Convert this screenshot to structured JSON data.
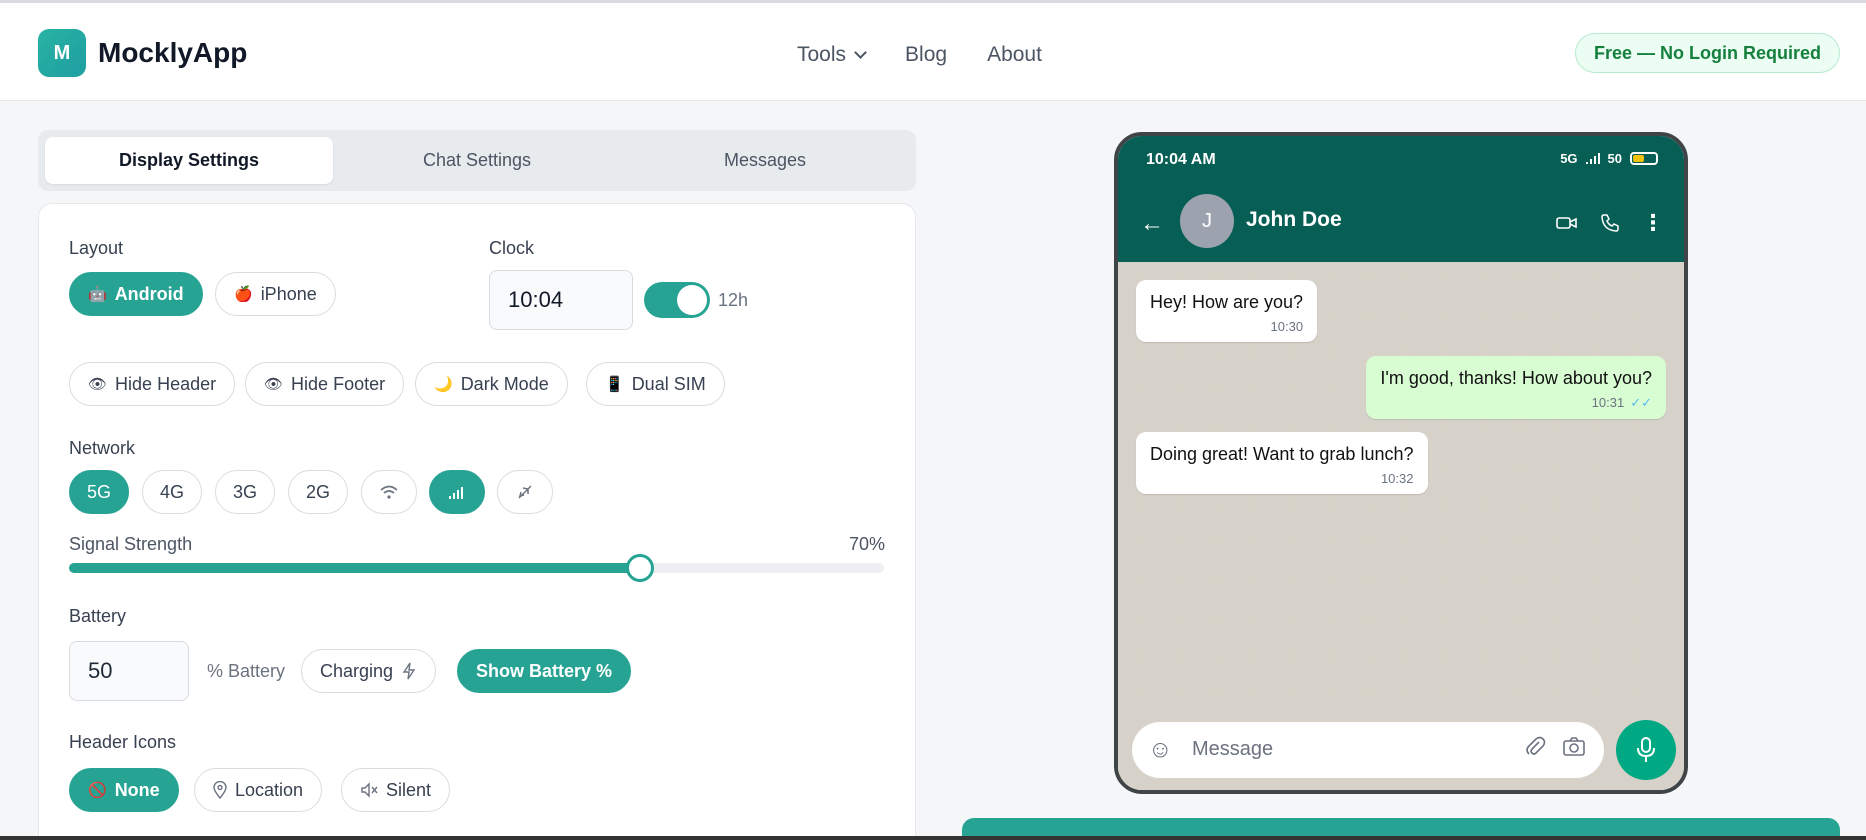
{
  "app": {
    "logo_letter": "M",
    "name": "MocklyApp"
  },
  "nav": {
    "tools": "Tools",
    "blog": "Blog",
    "about": "About",
    "badge": "Free — No Login Required"
  },
  "tabs": [
    "Display Settings",
    "Chat Settings",
    "Messages"
  ],
  "settings": {
    "layout_label": "Layout",
    "layout_android": "Android",
    "layout_iphone": "iPhone",
    "clock_label": "Clock",
    "clock_value": "10:04",
    "clock_format": "12h",
    "hide_header": "Hide Header",
    "hide_footer": "Hide Footer",
    "dark_mode": "Dark Mode",
    "dual_sim": "Dual SIM",
    "network_label": "Network",
    "networks": [
      "5G",
      "4G",
      "3G",
      "2G"
    ],
    "signal_label": "Signal Strength",
    "signal_value": "70%",
    "signal_fraction": 0.7,
    "battery_label": "Battery",
    "battery_value": "50",
    "battery_suffix": "% Battery",
    "charging": "Charging",
    "show_battery": "Show Battery %",
    "header_icons_label": "Header Icons",
    "hi_none": "None",
    "hi_location": "Location",
    "hi_silent": "Silent"
  },
  "phone": {
    "time": "10:04 AM",
    "network": "5G",
    "battery": "50",
    "battery_fraction": 0.5,
    "contact_initial": "J",
    "contact_name": "John Doe",
    "messages": [
      {
        "text": "Hey! How are you?",
        "time": "10:30"
      },
      {
        "text": "I'm good, thanks! How about you?",
        "time": "10:31"
      },
      {
        "text": "Doing great! Want to grab lunch?",
        "time": "10:32"
      }
    ],
    "input_placeholder": "Message"
  },
  "colors": {
    "accent": "#27a394",
    "whatsapp_header": "#075e54",
    "out_bubble": "#d9fdd3",
    "mic": "#00a884"
  }
}
